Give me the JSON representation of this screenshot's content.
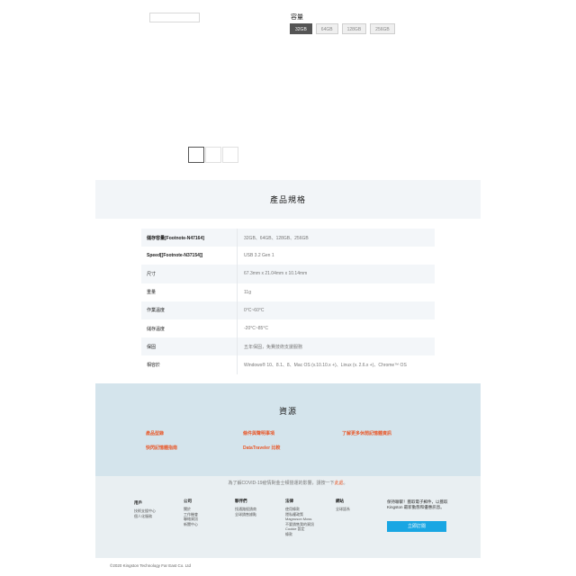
{
  "capacity": {
    "label": "容量",
    "options": [
      "32GB",
      "64GB",
      "128GB",
      "256GB"
    ],
    "selected": "32GB"
  },
  "specs": {
    "title": "產品規格",
    "rows": [
      {
        "key": "儲存容量[Footnote-N47164]",
        "value": "32GB、64GB、128GB、256GB",
        "bold": true
      },
      {
        "key": "Speed[[Footnote-N37154]]",
        "value": "USB 3.2 Gen 1",
        "bold": true
      },
      {
        "key": "尺寸",
        "value": "67.3mm x 21.04mm x 10.14mm",
        "bold": false
      },
      {
        "key": "重量",
        "value": "11g",
        "bold": false
      },
      {
        "key": "作業溫度",
        "value": "0°C~60°C",
        "bold": false
      },
      {
        "key": "儲存溫度",
        "value": "-20°C~85°C",
        "bold": false
      },
      {
        "key": "保固",
        "value": "五年保固，免費技術支援服務",
        "bold": false
      },
      {
        "key": "相容於",
        "value": "Windows® 10、8.1、8、Mac OS (v.10.10.x +)、Linux (v. 2.6.x +)、Chrome™ OS",
        "bold": false
      }
    ]
  },
  "resources": {
    "title": "資源",
    "links": [
      "產品型錄",
      "條件與聲明事項",
      "了解更多休閒記憶體資訊",
      "快閃記憶體指南",
      "DataTraveler 比較"
    ]
  },
  "footer": {
    "covid_text": "為了解COVID-19疫情對金士頓營運的影響，請按一下",
    "covid_link": "此處",
    "columns": [
      {
        "heading": "用戶",
        "items": [
          "技術支援中心",
          "個人化服務"
        ]
      },
      {
        "heading": "公司",
        "items": [
          "關於",
          "工作機會",
          "聯絡資訊",
          "新聞中心"
        ]
      },
      {
        "heading": "夥伴們",
        "items": [
          "找通路經銷商",
          "全球銷售據點"
        ]
      },
      {
        "heading": "法律",
        "items": [
          "使用條款",
          "隱私權政策",
          "Magnuson Moss",
          "不要銷售我的資訊",
          "Cookie 設定",
          "條款"
        ]
      },
      {
        "heading": "網站",
        "items": [
          "全球語系"
        ]
      }
    ],
    "subscribe_text": "保持聯繫！獲取電子郵件，以獲取 Kingston 最新動態和優惠訊息。",
    "subscribe_button": "立即訂閱"
  },
  "copyright": "©2020 Kingston Technology Far East Co. Ltd"
}
